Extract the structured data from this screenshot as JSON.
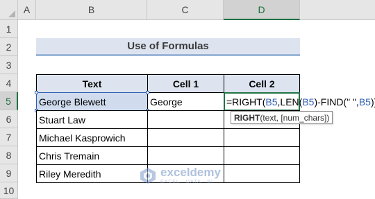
{
  "columns": [
    "A",
    "B",
    "C",
    "D"
  ],
  "active_column": "D",
  "rows": [
    "1",
    "2",
    "3",
    "4",
    "5",
    "6",
    "7",
    "8",
    "9",
    "10"
  ],
  "active_row": "5",
  "title": "Use of Formulas",
  "table": {
    "headers": [
      "Text",
      "Cell 1",
      "Cell 2"
    ],
    "names": [
      "George Blewett",
      "Stuart Law",
      "Michael Kasprowich",
      "Chris Tremain",
      "Riley Meredith"
    ],
    "cell1_values": [
      "George",
      "",
      "",
      "",
      ""
    ],
    "cell2_values": [
      "",
      "",
      "",
      "",
      ""
    ]
  },
  "formula": {
    "part1": "=RIGHT(",
    "ref1": "B5",
    "part2": ",LEN(",
    "ref2": "B5",
    "part3": ")-FIND(\" \",",
    "ref3": "B5",
    "part4": "))"
  },
  "tooltip": {
    "fn": "RIGHT",
    "args": "(text, [num_chars])"
  },
  "watermark": {
    "name": "exceldemy",
    "tagline": "EXCEL · DATA · BI"
  },
  "colors": {
    "excel_green": "#217346",
    "ref_blue": "#2f5fb4",
    "header_fill": "#dde4ef"
  }
}
